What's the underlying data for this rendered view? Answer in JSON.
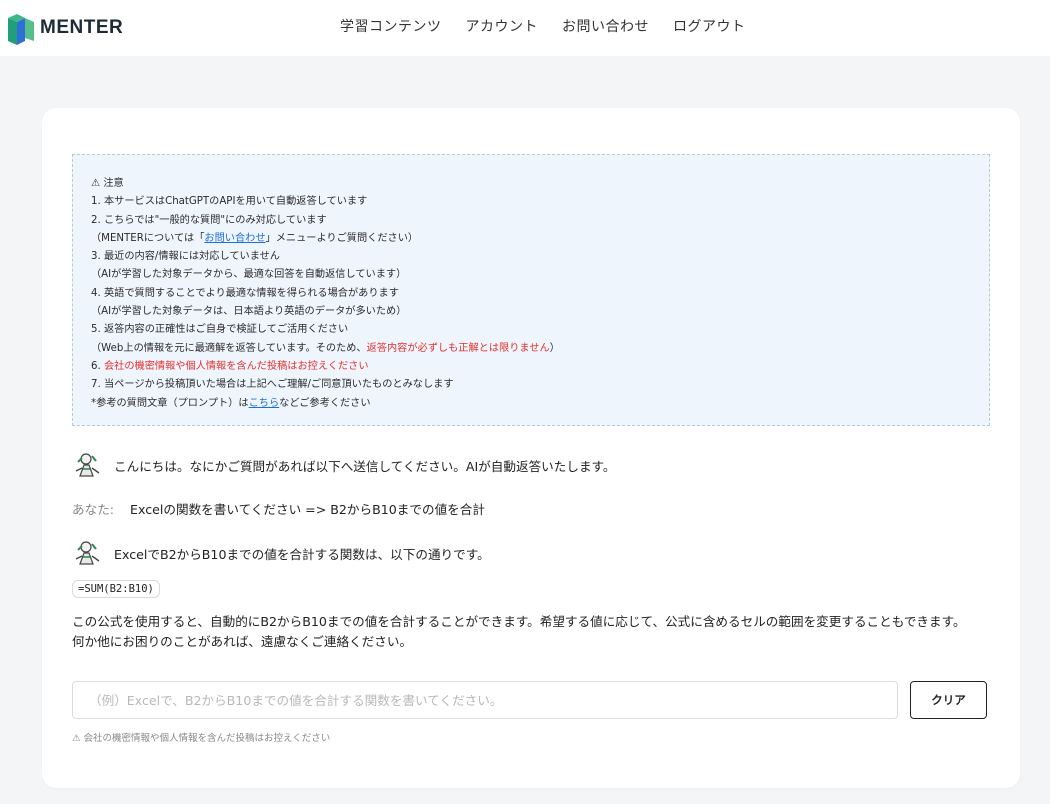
{
  "header": {
    "logo_text": "MENTER",
    "nav": [
      "学習コンテンツ",
      "アカウント",
      "お問い合わせ",
      "ログアウト"
    ]
  },
  "notice": {
    "title": "⚠ 注意",
    "l1": "1. 本サービスはChatGPTのAPIを用いて自動返答しています",
    "l2": "2. こちらでは\"一般的な質問\"にのみ対応しています",
    "l3_pre": "（MENTERについては「",
    "l3_link": "お問い合わせ",
    "l3_post": "」メニューよりご質問ください）",
    "l4": "3. 最近の内容/情報には対応していません",
    "l5": "（AIが学習した対象データから、最適な回答を自動返信しています）",
    "l6": "4. 英語で質問することでより最適な情報を得られる場合があります",
    "l7": "（AIが学習した対象データは、日本語より英語のデータが多いため）",
    "l8": "5. 返答内容の正確性はご自身で検証してご活用ください",
    "l9_pre": "（Web上の情報を元に最適解を返答しています。そのため、",
    "l9_red": "返答内容が必ずしも正解とは限りません",
    "l9_post": "）",
    "l10_num": "6. ",
    "l10_red": "会社の機密情報や個人情報を含んだ投稿はお控えください",
    "l11": "7. 当ページから投稿頂いた場合は上記へご理解/ご同意頂いたものとみなします",
    "l12_pre": "*参考の質問文章（プロンプト）は",
    "l12_link": "こちら",
    "l12_post": "などご参考ください"
  },
  "chat": {
    "greeting": "こんにちは。なにかご質問があれば以下へ送信してください。AIが自動返答いたします。",
    "you_label": "あなた:",
    "user_message": "Excelの関数を書いてください => B2からB10までの値を合計",
    "bot_reply": "ExcelでB2からB10までの値を合計する関数は、以下の通りです。",
    "code": "=SUM(B2:B10)",
    "answer_1": "この公式を使用すると、自動的にB2からB10までの値を合計することができます。希望する値に応じて、公式に含めるセルの範囲を変更することもできます。",
    "answer_2": "何か他にお困りのことがあれば、遠慮なくご連絡ください。"
  },
  "input": {
    "value": "",
    "placeholder": "（例）Excelで、B2からB10までの値を合計する関数を書いてください。",
    "clear_label": "クリア"
  },
  "footnote": "⚠ 会社の機密情報や個人情報を含んだ投稿はお控えください",
  "colors": {
    "notice_bg": "#eef5fd",
    "warning_red": "#e5322d",
    "link_blue": "#1a6ed8",
    "logo_green": "#27a67a",
    "logo_blue": "#2a6fd6"
  }
}
